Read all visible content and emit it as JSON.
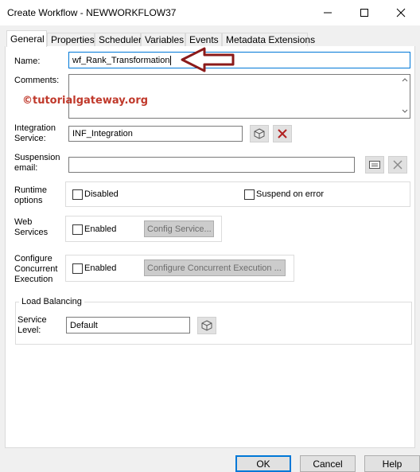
{
  "window": {
    "title": "Create Workflow - NEWWORKFLOW37",
    "controls": [
      "minimize-icon",
      "maximize-icon",
      "close-icon"
    ]
  },
  "tabs": [
    {
      "label": "General",
      "active": true
    },
    {
      "label": "Properties",
      "active": false
    },
    {
      "label": "Scheduler",
      "active": false
    },
    {
      "label": "Variables",
      "active": false
    },
    {
      "label": "Events",
      "active": false
    },
    {
      "label": "Metadata Extensions",
      "active": false
    }
  ],
  "general": {
    "name_label": "Name:",
    "name_value": "wf_Rank_Transformation",
    "comments_label": "Comments:",
    "comments_value": "",
    "watermark": "©tutorialgateway.org",
    "integration_label_line1": "Integration",
    "integration_label_line2": "Service:",
    "integration_value": "INF_Integration",
    "suspension_label_line1": "Suspension",
    "suspension_label_line2": "email:",
    "suspension_value": "",
    "runtime_label_line1": "Runtime",
    "runtime_label_line2": "options",
    "disabled_label": "Disabled",
    "suspend_on_error_label": "Suspend on error",
    "web_label_line1": "Web",
    "web_label_line2": "Services",
    "web_enabled_label": "Enabled",
    "config_service_label": "Config Service...",
    "concurrent_label_line1": "Configure",
    "concurrent_label_line2": "Concurrent",
    "concurrent_label_line3": "Execution",
    "concurrent_enabled_label": "Enabled",
    "configure_concurrent_label": "Configure Concurrent Execution ...",
    "load_balancing_title": "Load Balancing",
    "service_level_label_line1": "Service",
    "service_level_label_line2": "Level:",
    "service_level_value": "Default"
  },
  "footer": {
    "ok_label": "OK",
    "cancel_label": "Cancel",
    "help_label": "Help"
  },
  "colors": {
    "accent": "#0078d7",
    "arrow": "#8b1a1a",
    "delete_x": "#b22222",
    "watermark": "#c0392b"
  }
}
